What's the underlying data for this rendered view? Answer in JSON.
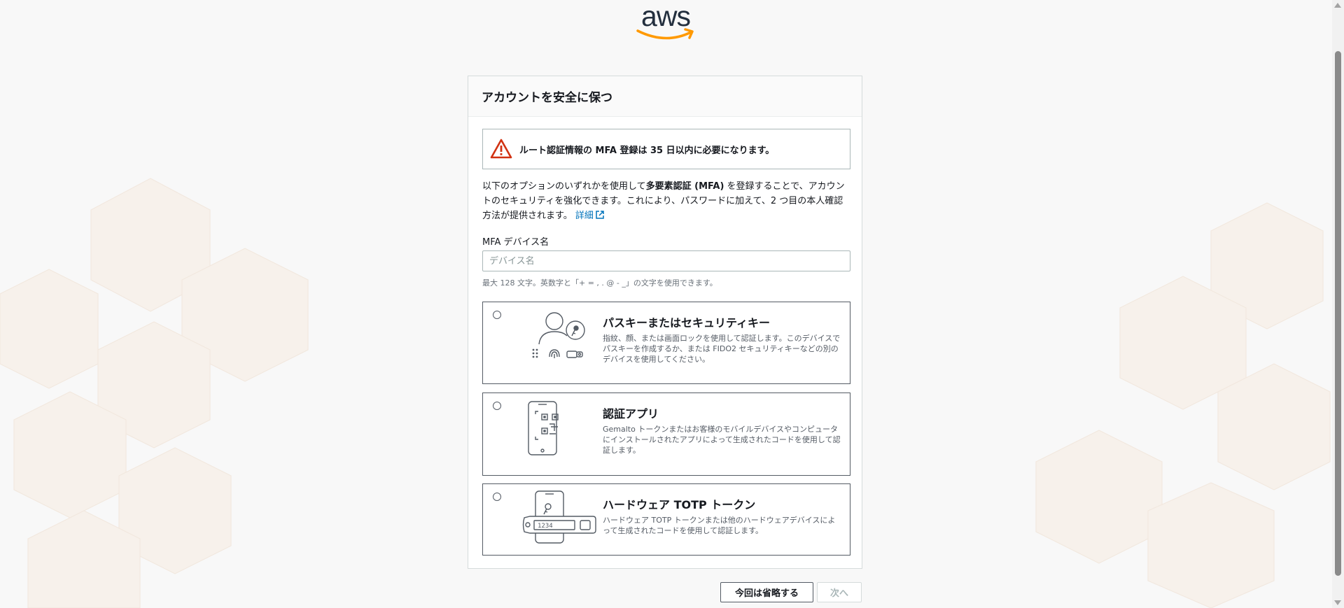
{
  "brand": {
    "logo_text": "aws",
    "accent": "#ff9900"
  },
  "card": {
    "title": "アカウントを安全に保つ",
    "alert": {
      "icon": "warning-triangle-icon",
      "color": "#d13212",
      "text": "ルート認証情報の MFA 登録は 35 日以内に必要になります。"
    },
    "description": {
      "part1": "以下のオプションのいずれかを使用して",
      "bold": "多要素認証 (MFA)",
      "part2": " を登録することで、アカウントのセキュリティを強化できます。これにより、パスワードに加えて、2 つ目の本人確認方法が提供されます。",
      "link": "詳細"
    },
    "device_name": {
      "label": "MFA デバイス名",
      "placeholder": "デバイス名",
      "value": "",
      "hint": "最大 128 文字。英数字と「+ = , . @ - _」の文字を使用できます。"
    },
    "options": [
      {
        "title": "パスキーまたはセキュリティキー",
        "description": "指紋、顔、または画面ロックを使用して認証します。このデバイスでパスキーを作成するか、または FIDO2 セキュリティキーなどの別のデバイスを使用してください。",
        "icon": "passkey-icon",
        "selected": false
      },
      {
        "title": "認証アプリ",
        "description": "Gemalto トークンまたはお客様のモバイルデバイスやコンピュータにインストールされたアプリによって生成されたコードを使用して認証します。",
        "icon": "authenticator-app-icon",
        "selected": false
      },
      {
        "title": "ハードウェア TOTP トークン",
        "description": "ハードウェア TOTP トークンまたは他のハードウェアデバイスによって生成されたコードを使用して認証します。",
        "icon": "hardware-token-icon",
        "token_display": "1234",
        "selected": false
      }
    ]
  },
  "buttons": {
    "skip": "今回は省略する",
    "next": "次へ"
  }
}
